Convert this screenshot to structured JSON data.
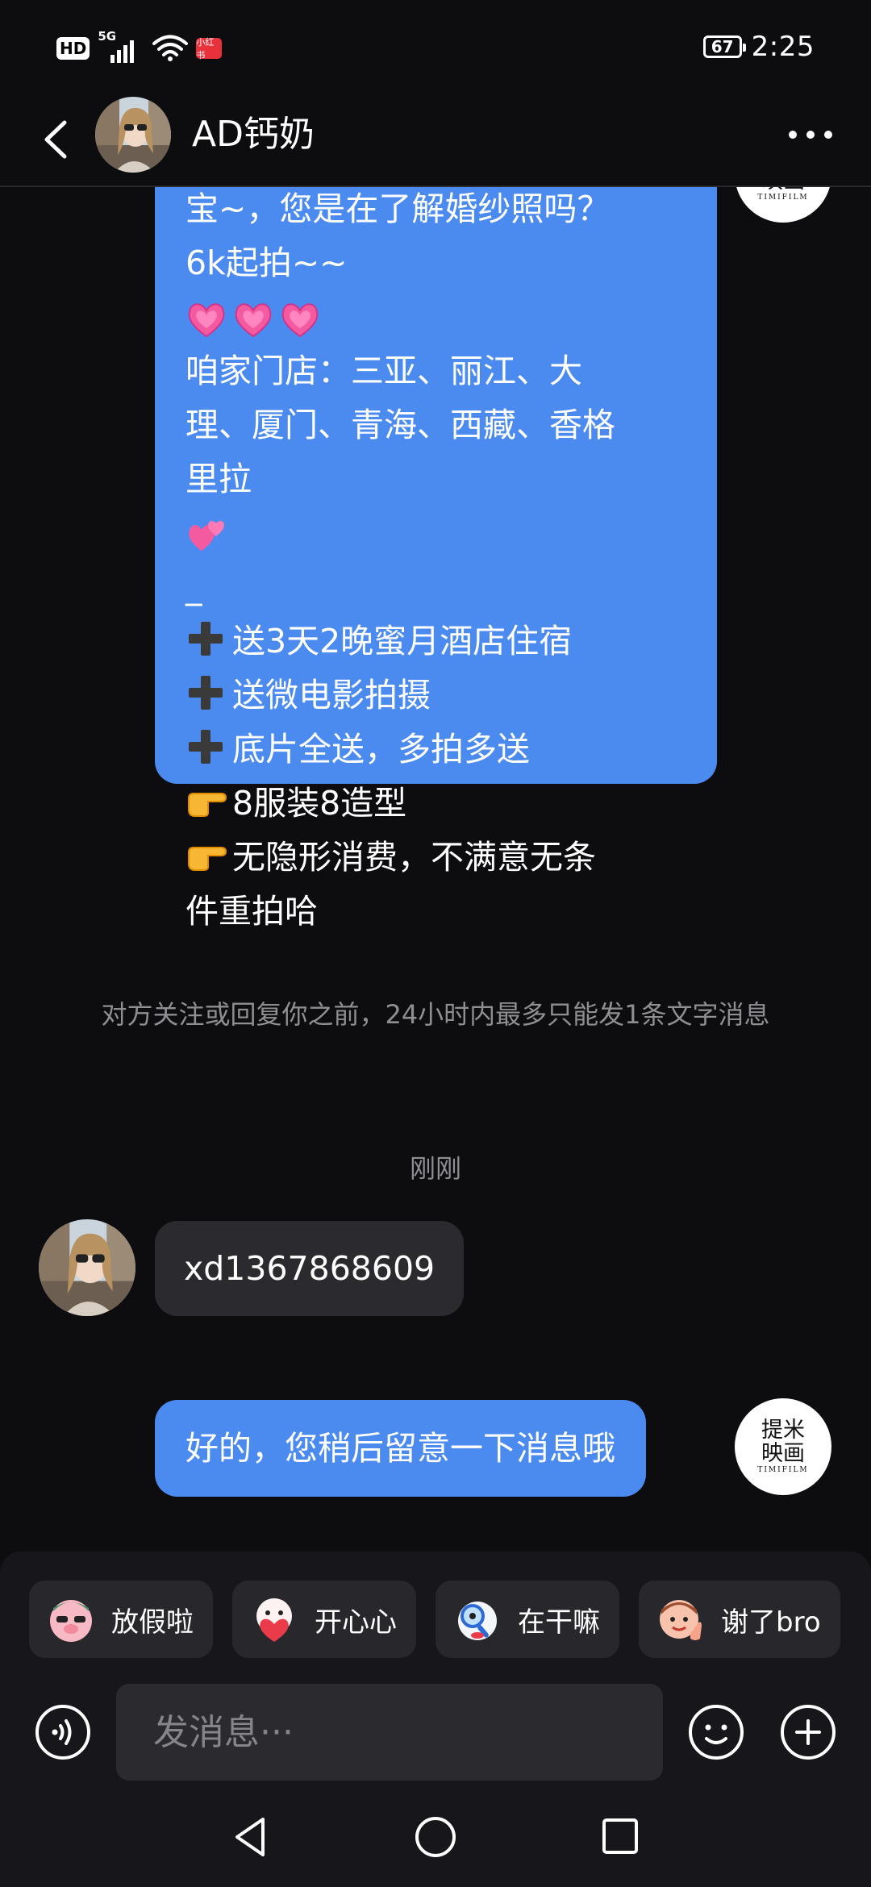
{
  "status_bar": {
    "hd": "HD",
    "network": "5G",
    "app_badge": "小红书",
    "battery": "67",
    "time": "2:25"
  },
  "header": {
    "contact_name": "AD钙奶",
    "back_icon": "chevron-left-icon",
    "more_icon": "more-dots-icon"
  },
  "messages": {
    "promo_lines": [
      "宝~，您是在了解婚纱照吗？",
      "6k起拍~~",
      "咱家门店：三亚、丽江、大",
      "理、厦门、青海、西藏、香格",
      "里拉",
      "_",
      "送3天2晚蜜月酒店住宿",
      "送微电影拍摄",
      "底片全送，多拍多送",
      "8服装8造型",
      "无隐形消费，不满意无条",
      "件重拍哈"
    ],
    "brand_avatar": {
      "line1": "提米",
      "line2": "映画",
      "line3": "TIMIFILM"
    },
    "notice": "对方关注或回复你之前，24小时内最多只能发1条文字消息",
    "timestamp": "刚刚",
    "incoming": "xd1367868609",
    "reply": "好的，您稍后留意一下消息哦"
  },
  "quick_replies": [
    {
      "label": "放假啦",
      "icon": "pig-sticker-icon"
    },
    {
      "label": "开心心",
      "icon": "heart-sticker-icon"
    },
    {
      "label": "在干嘛",
      "icon": "magnifier-sticker-icon"
    },
    {
      "label": "谢了bro",
      "icon": "thumb-sticker-icon"
    }
  ],
  "composer": {
    "placeholder": "发消息···",
    "voice_icon": "voice-icon",
    "emoji_icon": "emoji-icon",
    "plus_icon": "plus-icon"
  },
  "colors": {
    "background": "#0d0d10",
    "bubble_blue": "#4b8bf0",
    "bubble_gray": "#2b2b2f",
    "muted_text": "#8e8e93"
  }
}
